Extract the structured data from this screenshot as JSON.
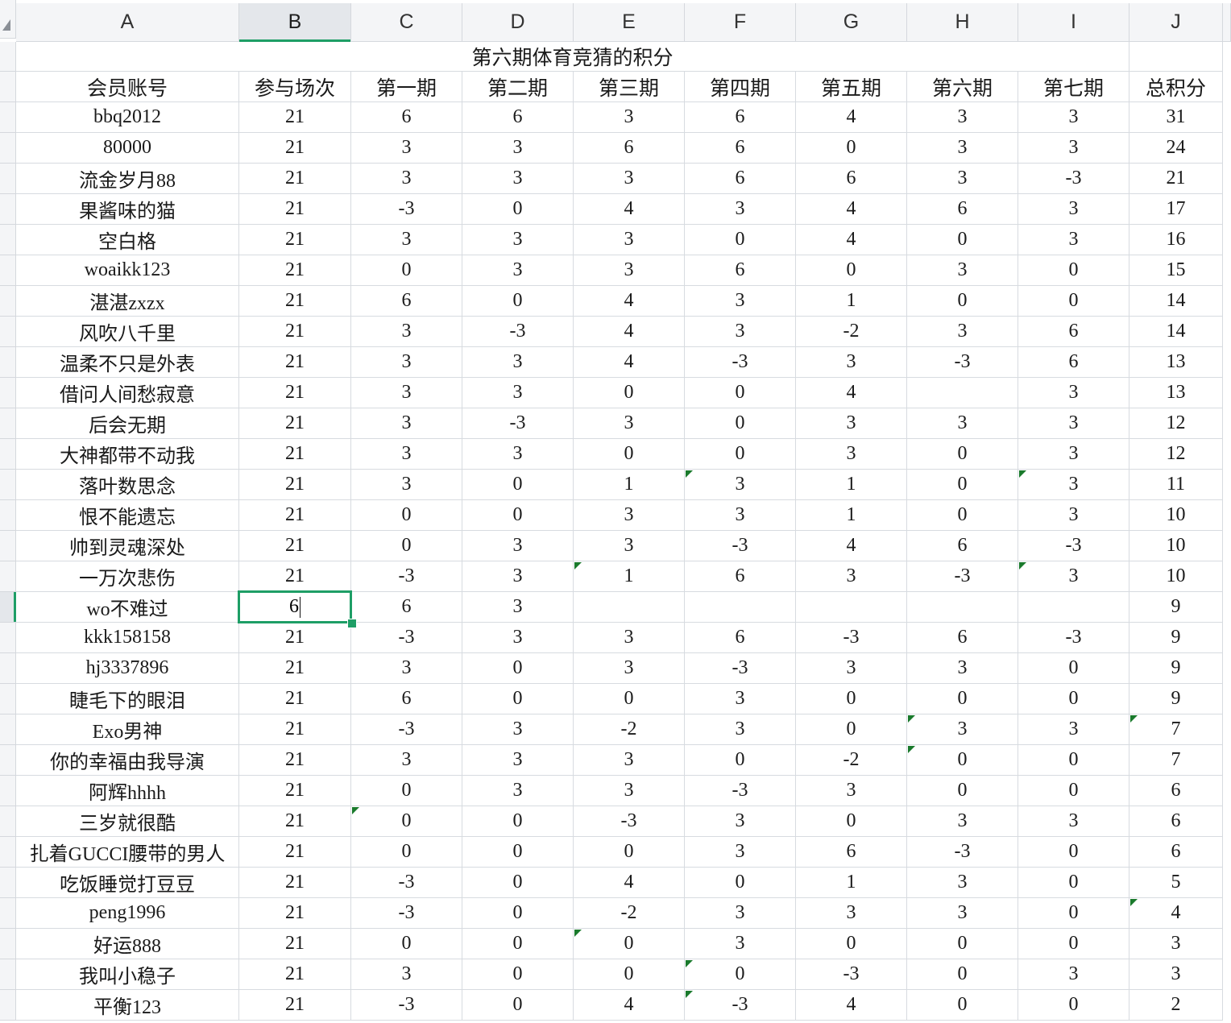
{
  "columns": [
    "A",
    "B",
    "C",
    "D",
    "E",
    "F",
    "G",
    "H",
    "I",
    "J"
  ],
  "active_column": "B",
  "title": "第六期体育竞猜的积分",
  "headers": [
    "会员账号",
    "参与场次",
    "第一期",
    "第二期",
    "第三期",
    "第四期",
    "第五期",
    "第六期",
    "第七期",
    "总积分"
  ],
  "rows": [
    [
      "bbq2012",
      "21",
      "6",
      "6",
      "3",
      "6",
      "4",
      "3",
      "3",
      "31"
    ],
    [
      "80000",
      "21",
      "3",
      "3",
      "6",
      "6",
      "0",
      "3",
      "3",
      "24"
    ],
    [
      "流金岁月88",
      "21",
      "3",
      "3",
      "3",
      "6",
      "6",
      "3",
      "-3",
      "21"
    ],
    [
      "果酱味的猫",
      "21",
      "-3",
      "0",
      "4",
      "3",
      "4",
      "6",
      "3",
      "17"
    ],
    [
      "空白格",
      "21",
      "3",
      "3",
      "3",
      "0",
      "4",
      "0",
      "3",
      "16"
    ],
    [
      "woaikk123",
      "21",
      "0",
      "3",
      "3",
      "6",
      "0",
      "3",
      "0",
      "15"
    ],
    [
      "湛湛zxzx",
      "21",
      "6",
      "0",
      "4",
      "3",
      "1",
      "0",
      "0",
      "14"
    ],
    [
      "风吹八千里",
      "21",
      "3",
      "-3",
      "4",
      "3",
      "-2",
      "3",
      "6",
      "14"
    ],
    [
      "温柔不只是外表",
      "21",
      "3",
      "3",
      "4",
      "-3",
      "3",
      "-3",
      "6",
      "13"
    ],
    [
      "借问人间愁寂意",
      "21",
      "3",
      "3",
      "0",
      "0",
      "4",
      "",
      "3",
      "13"
    ],
    [
      "后会无期",
      "21",
      "3",
      "-3",
      "3",
      "0",
      "3",
      "3",
      "3",
      "12"
    ],
    [
      "大神都带不动我",
      "21",
      "3",
      "3",
      "0",
      "0",
      "3",
      "0",
      "3",
      "12"
    ],
    [
      "落叶数思念",
      "21",
      "3",
      "0",
      "1",
      "3",
      "1",
      "0",
      "3",
      "11"
    ],
    [
      "恨不能遗忘",
      "21",
      "0",
      "0",
      "3",
      "3",
      "1",
      "0",
      "3",
      "10"
    ],
    [
      "帅到灵魂深处",
      "21",
      "0",
      "3",
      "3",
      "-3",
      "4",
      "6",
      "-3",
      "10"
    ],
    [
      "一万次悲伤",
      "21",
      "-3",
      "3",
      "1",
      "6",
      "3",
      "-3",
      "3",
      "10"
    ],
    [
      "wo不难过",
      "6",
      "6",
      "3",
      "",
      "",
      "",
      "",
      "",
      "9"
    ],
    [
      "kkk158158",
      "21",
      "-3",
      "3",
      "3",
      "6",
      "-3",
      "6",
      "-3",
      "9"
    ],
    [
      "hj3337896",
      "21",
      "3",
      "0",
      "3",
      "-3",
      "3",
      "3",
      "0",
      "9"
    ],
    [
      "睫毛下的眼泪",
      "21",
      "6",
      "0",
      "0",
      "3",
      "0",
      "0",
      "0",
      "9"
    ],
    [
      "Exo男神",
      "21",
      "-3",
      "3",
      "-2",
      "3",
      "0",
      "3",
      "3",
      "7"
    ],
    [
      "你的幸福由我导演",
      "21",
      "3",
      "3",
      "3",
      "0",
      "-2",
      "0",
      "0",
      "7"
    ],
    [
      "阿辉hhhh",
      "21",
      "0",
      "3",
      "3",
      "-3",
      "3",
      "0",
      "0",
      "6"
    ],
    [
      "三岁就很酷",
      "21",
      "0",
      "0",
      "-3",
      "3",
      "0",
      "3",
      "3",
      "6"
    ],
    [
      "扎着GUCCI腰带的男人",
      "21",
      "0",
      "0",
      "0",
      "3",
      "6",
      "-3",
      "0",
      "6"
    ],
    [
      "吃饭睡觉打豆豆",
      "21",
      "-3",
      "0",
      "4",
      "0",
      "1",
      "3",
      "0",
      "5"
    ],
    [
      "peng1996",
      "21",
      "-3",
      "0",
      "-2",
      "3",
      "3",
      "3",
      "0",
      "4"
    ],
    [
      "好运888",
      "21",
      "0",
      "0",
      "0",
      "3",
      "0",
      "0",
      "0",
      "3"
    ],
    [
      "我叫小稳子",
      "21",
      "3",
      "0",
      "0",
      "0",
      "-3",
      "0",
      "3",
      "3"
    ],
    [
      "平衡123",
      "21",
      "-3",
      "0",
      "4",
      "-3",
      "4",
      "0",
      "0",
      "2"
    ]
  ],
  "selected_cell": {
    "row": 16,
    "col": 1,
    "value": "6"
  },
  "indicator_marks": [
    [
      12,
      5
    ],
    [
      12,
      8
    ],
    [
      15,
      4
    ],
    [
      15,
      8
    ],
    [
      20,
      7
    ],
    [
      20,
      9
    ],
    [
      21,
      7
    ],
    [
      23,
      2
    ],
    [
      26,
      9
    ],
    [
      27,
      4
    ],
    [
      28,
      5
    ],
    [
      29,
      5
    ]
  ],
  "colors": {
    "selection": "#1e9e66",
    "indicator": "#1a7a2c",
    "grid": "#d7dbe0",
    "header_bg": "#f4f5f7"
  }
}
